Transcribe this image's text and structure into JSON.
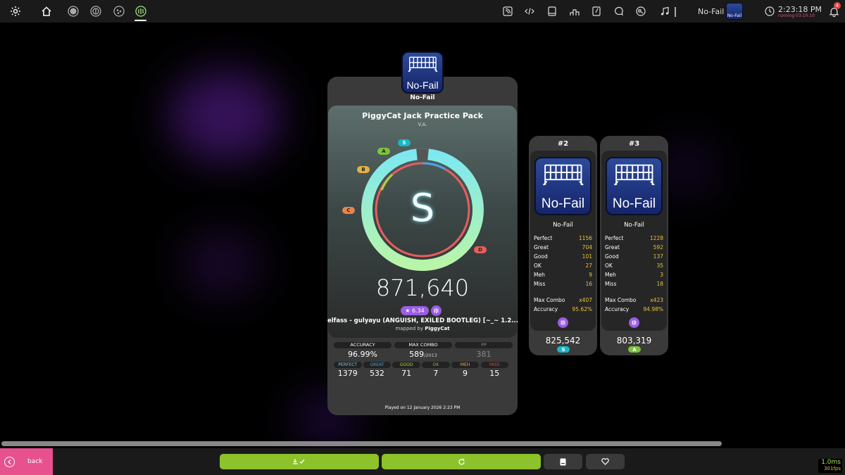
{
  "toolbar": {
    "mod_label": "No-Fail",
    "time": "2:23:18 PM",
    "running": "running 03:10:10",
    "notification_count": "4",
    "left_icons": [
      "settings-icon",
      "home-icon",
      "osu-ruleset-icon",
      "taiko-ruleset-icon",
      "catch-ruleset-icon",
      "mania-ruleset-icon"
    ],
    "right_icons": [
      "news-icon",
      "developer-icon",
      "beatmap-listing-icon",
      "rankings-icon",
      "wiki-icon",
      "chat-icon",
      "dashboard-icon",
      "music-icon"
    ]
  },
  "main": {
    "mod_name": "No-Fail",
    "title": "PiggyCat Jack Practice Pack",
    "artist": "V.A.",
    "rank": "S",
    "score": "871,640",
    "star_rating": "★ 6.34",
    "difficulty": "elfass - gulyayu (ANGUISH, EXILED BOOTLEG) [~_~ 1.2...",
    "mapped_by_prefix": "mapped by",
    "mapper": "PiggyCat",
    "grade_labels": [
      "S",
      "A",
      "B",
      "C",
      "D"
    ],
    "accuracy_label": "ACCURACY",
    "accuracy_value": "96.99%",
    "maxcombo_label": "MAX COMBO",
    "maxcombo_value": "589",
    "maxcombo_total": "/2013",
    "pp_label": "PP",
    "pp_value": "381",
    "judgements": [
      {
        "label": "PERFECT",
        "value": "1379",
        "color": "#7dc4e8"
      },
      {
        "label": "GREAT",
        "value": "532",
        "color": "#4da3d8"
      },
      {
        "label": "GOOD",
        "value": "71",
        "color": "#a4d93a"
      },
      {
        "label": "OK",
        "value": "7",
        "color": "#7ec23a"
      },
      {
        "label": "MEH",
        "value": "9",
        "color": "#e0b341"
      },
      {
        "label": "MISS",
        "value": "15",
        "color": "#e04545"
      }
    ],
    "played_on": "Played on 12 January 2026 2:23 PM"
  },
  "cards": [
    {
      "position": "#2",
      "mod_name": "No-Fail",
      "stats": [
        {
          "label": "Perfect",
          "value": "1156"
        },
        {
          "label": "Great",
          "value": "704"
        },
        {
          "label": "Good",
          "value": "101"
        },
        {
          "label": "OK",
          "value": "27"
        },
        {
          "label": "Meh",
          "value": "9"
        },
        {
          "label": "Miss",
          "value": "16"
        }
      ],
      "max_combo_label": "Max Combo",
      "max_combo": "x407",
      "accuracy_label": "Accuracy",
      "accuracy": "95.62%",
      "score": "825,542",
      "rank": "S",
      "rank_color": "#16b8c9"
    },
    {
      "position": "#3",
      "mod_name": "No-Fail",
      "stats": [
        {
          "label": "Perfect",
          "value": "1228"
        },
        {
          "label": "Great",
          "value": "592"
        },
        {
          "label": "Good",
          "value": "137"
        },
        {
          "label": "OK",
          "value": "35"
        },
        {
          "label": "Meh",
          "value": "3"
        },
        {
          "label": "Miss",
          "value": "18"
        }
      ],
      "max_combo_label": "Max Combo",
      "max_combo": "x423",
      "accuracy_label": "Accuracy",
      "accuracy": "94.98%",
      "score": "803,319",
      "rank": "A",
      "rank_color": "#7cc43a"
    }
  ],
  "bottom": {
    "back_label": "back",
    "fps_ms": "1.0ms",
    "fps": "301fps"
  },
  "colors": {
    "accent_green": "#8cc22a",
    "back_pink": "#e6518e",
    "gold": "#e8c23d",
    "purple": "#9b5de5"
  }
}
